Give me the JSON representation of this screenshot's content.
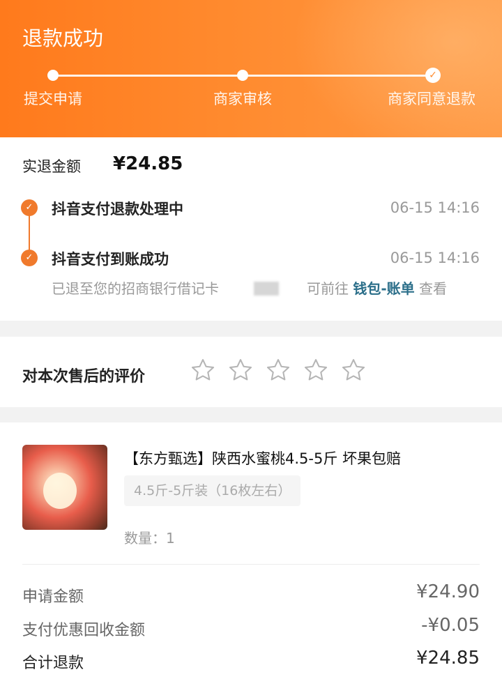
{
  "header": {
    "title": "退款成功",
    "steps": [
      {
        "label": "提交申请"
      },
      {
        "label": "商家审核"
      },
      {
        "label": "商家同意退款"
      }
    ]
  },
  "refund": {
    "amount_label": "实退金额",
    "amount_value": "¥24.85",
    "timeline": [
      {
        "text": "抖音支付退款处理中",
        "time": "06-15 14:16"
      },
      {
        "text": "抖音支付到账成功",
        "time": "06-15 14:16"
      }
    ],
    "note_prefix": "已退至您的招商银行借记卡",
    "note_goto": "可前往",
    "note_link": "钱包-账单",
    "note_suffix": "查看"
  },
  "rating": {
    "label": "对本次售后的评价",
    "stars_total": 5,
    "stars_filled": 0
  },
  "product": {
    "title": "【东方甄选】陕西水蜜桃4.5-5斤 坏果包赔",
    "spec": "4.5斤-5斤装（16枚左右）",
    "quantity": "数量：1"
  },
  "summary": [
    {
      "label": "申请金额",
      "value": "¥24.90"
    },
    {
      "label": "支付优惠回收金额",
      "value": "-¥0.05"
    },
    {
      "label": "合计退款",
      "value": "¥24.85"
    }
  ],
  "colors": {
    "accent": "#f07a2c",
    "header_gradient_start": "#ff7a1c",
    "header_gradient_end": "#ff9a45",
    "link": "#2c6f8a"
  }
}
